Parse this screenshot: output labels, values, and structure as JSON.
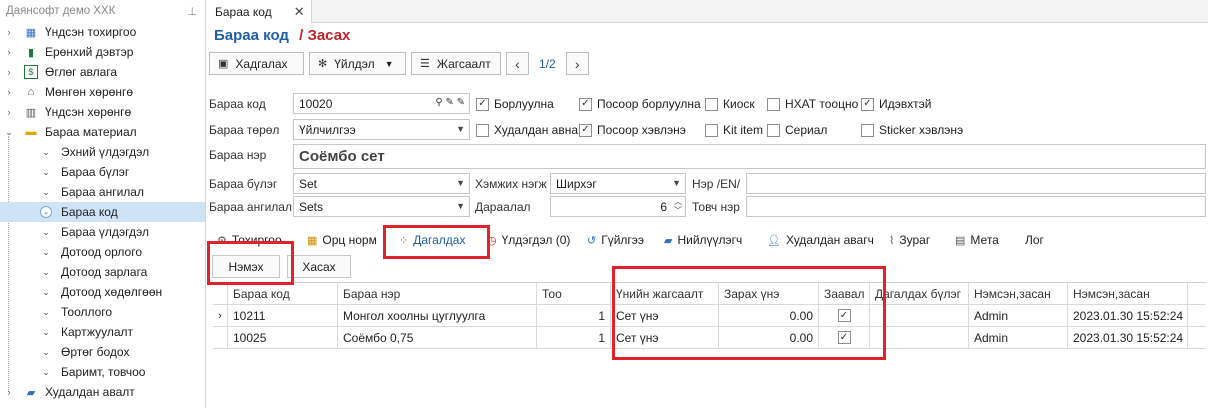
{
  "sidebar": {
    "title": "Даянсофт демо ХХК",
    "items": [
      {
        "label": "Үндсэн тохиргоо",
        "icon": "grid-settings-icon",
        "color": "#2f6fbf"
      },
      {
        "label": "Ерөнхий дэвтэр",
        "icon": "book-icon",
        "color": "#1e7a3a"
      },
      {
        "label": "Өглөг авлага",
        "icon": "dollar-icon",
        "color": "#1e7a3a"
      },
      {
        "label": "Мөнгөн хөрөнгө",
        "icon": "bank-icon",
        "color": "#555555"
      },
      {
        "label": "Үндсэн хөрөнгө",
        "icon": "building-icon",
        "color": "#555555"
      },
      {
        "label": "Бараа материал",
        "icon": "box-icon",
        "color": "#e5a300"
      }
    ],
    "children": [
      "Эхний үлдэгдэл",
      "Бараа бүлэг",
      "Бараа ангилал",
      "Бараа код",
      "Бараа үлдэгдэл",
      "Дотоод орлого",
      "Дотоод зарлага",
      "Дотоод хөдөлгөөн",
      "Тооллого",
      "Картжуулалт",
      "Өртөг бодох",
      "Баримт, товчоо"
    ],
    "after": [
      {
        "label": "Худалдан авалт",
        "icon": "truck-icon",
        "color": "#2f6fbf"
      }
    ]
  },
  "doc_tab": {
    "label": "Бараа код"
  },
  "heading": {
    "title": "Бараа код",
    "mode": "/ Засах"
  },
  "toolbar": {
    "save": "Хадгалах",
    "actions": "Үйлдэл",
    "list": "Жагсаалт",
    "pager": "1/2"
  },
  "form": {
    "code_label": "Бараа код",
    "code_value": "10020",
    "type_label": "Бараа төрөл",
    "type_value": "Үйлчилгээ",
    "name_label": "Бараа нэр",
    "name_value": "Соёмбо сет",
    "group_label": "Бараа бүлэг",
    "group_value": "Set",
    "category_label": "Бараа ангилал",
    "category_value": "Sets",
    "unit_label": "Хэмжих нэгж",
    "unit_value": "Ширхэг",
    "order_label": "Дараалал",
    "order_value": "6",
    "name_en_label": "Нэр /EN/",
    "short_label": "Товч нэр",
    "checks": {
      "sellable": "Борлуулна",
      "pos_sell": "Посоор борлуулна",
      "kiosk": "Киоск",
      "vat": "НХАТ тооцно",
      "active": "Идэвхтэй",
      "purchase": "Худалдан авна",
      "pos_use": "Посоор хэвлэнэ",
      "kit": "Kit item",
      "serial": "Сериал",
      "sticker": "Sticker хэвлэнэ"
    }
  },
  "detail_tabs": {
    "settings": "Тохиргоо",
    "component": "Орц норм",
    "accompany": "Дагалдах",
    "balance": "Үлдэгдэл (0)",
    "transaction": "Гүйлгээ",
    "supplier": "Нийлүүлэгч",
    "buyer": "Худалдан авагч",
    "image": "Зураг",
    "meta": "Мета",
    "log": "Лог"
  },
  "sub_buttons": {
    "add": "Нэмэх",
    "remove": "Хасах"
  },
  "grid": {
    "columns": [
      "Бараа код",
      "Бараа нэр",
      "Тоо",
      "Үнийн жагсаалт",
      "Зарах үнэ",
      "Заавал",
      "Дагалдах бүлэг",
      "Нэмсэн,засан",
      "Нэмсэн,засан"
    ],
    "rows": [
      {
        "code": "10211",
        "name": "Монгол хоолны цуглуулга",
        "qty": "1",
        "pricelist": "Сет үнэ",
        "price": "0.00",
        "required": true,
        "group": "",
        "user": "Admin",
        "date": "2023.01.30 15:52:24"
      },
      {
        "code": "10025",
        "name": "Соёмбо 0,75",
        "qty": "1",
        "pricelist": "Сет үнэ",
        "price": "0.00",
        "required": true,
        "group": "",
        "user": "Admin",
        "date": "2023.01.30 15:52:24"
      }
    ]
  },
  "colors": {
    "accent": "#1f5fa8",
    "highlight": "#e0232a",
    "selected": "#cfe3f7"
  }
}
